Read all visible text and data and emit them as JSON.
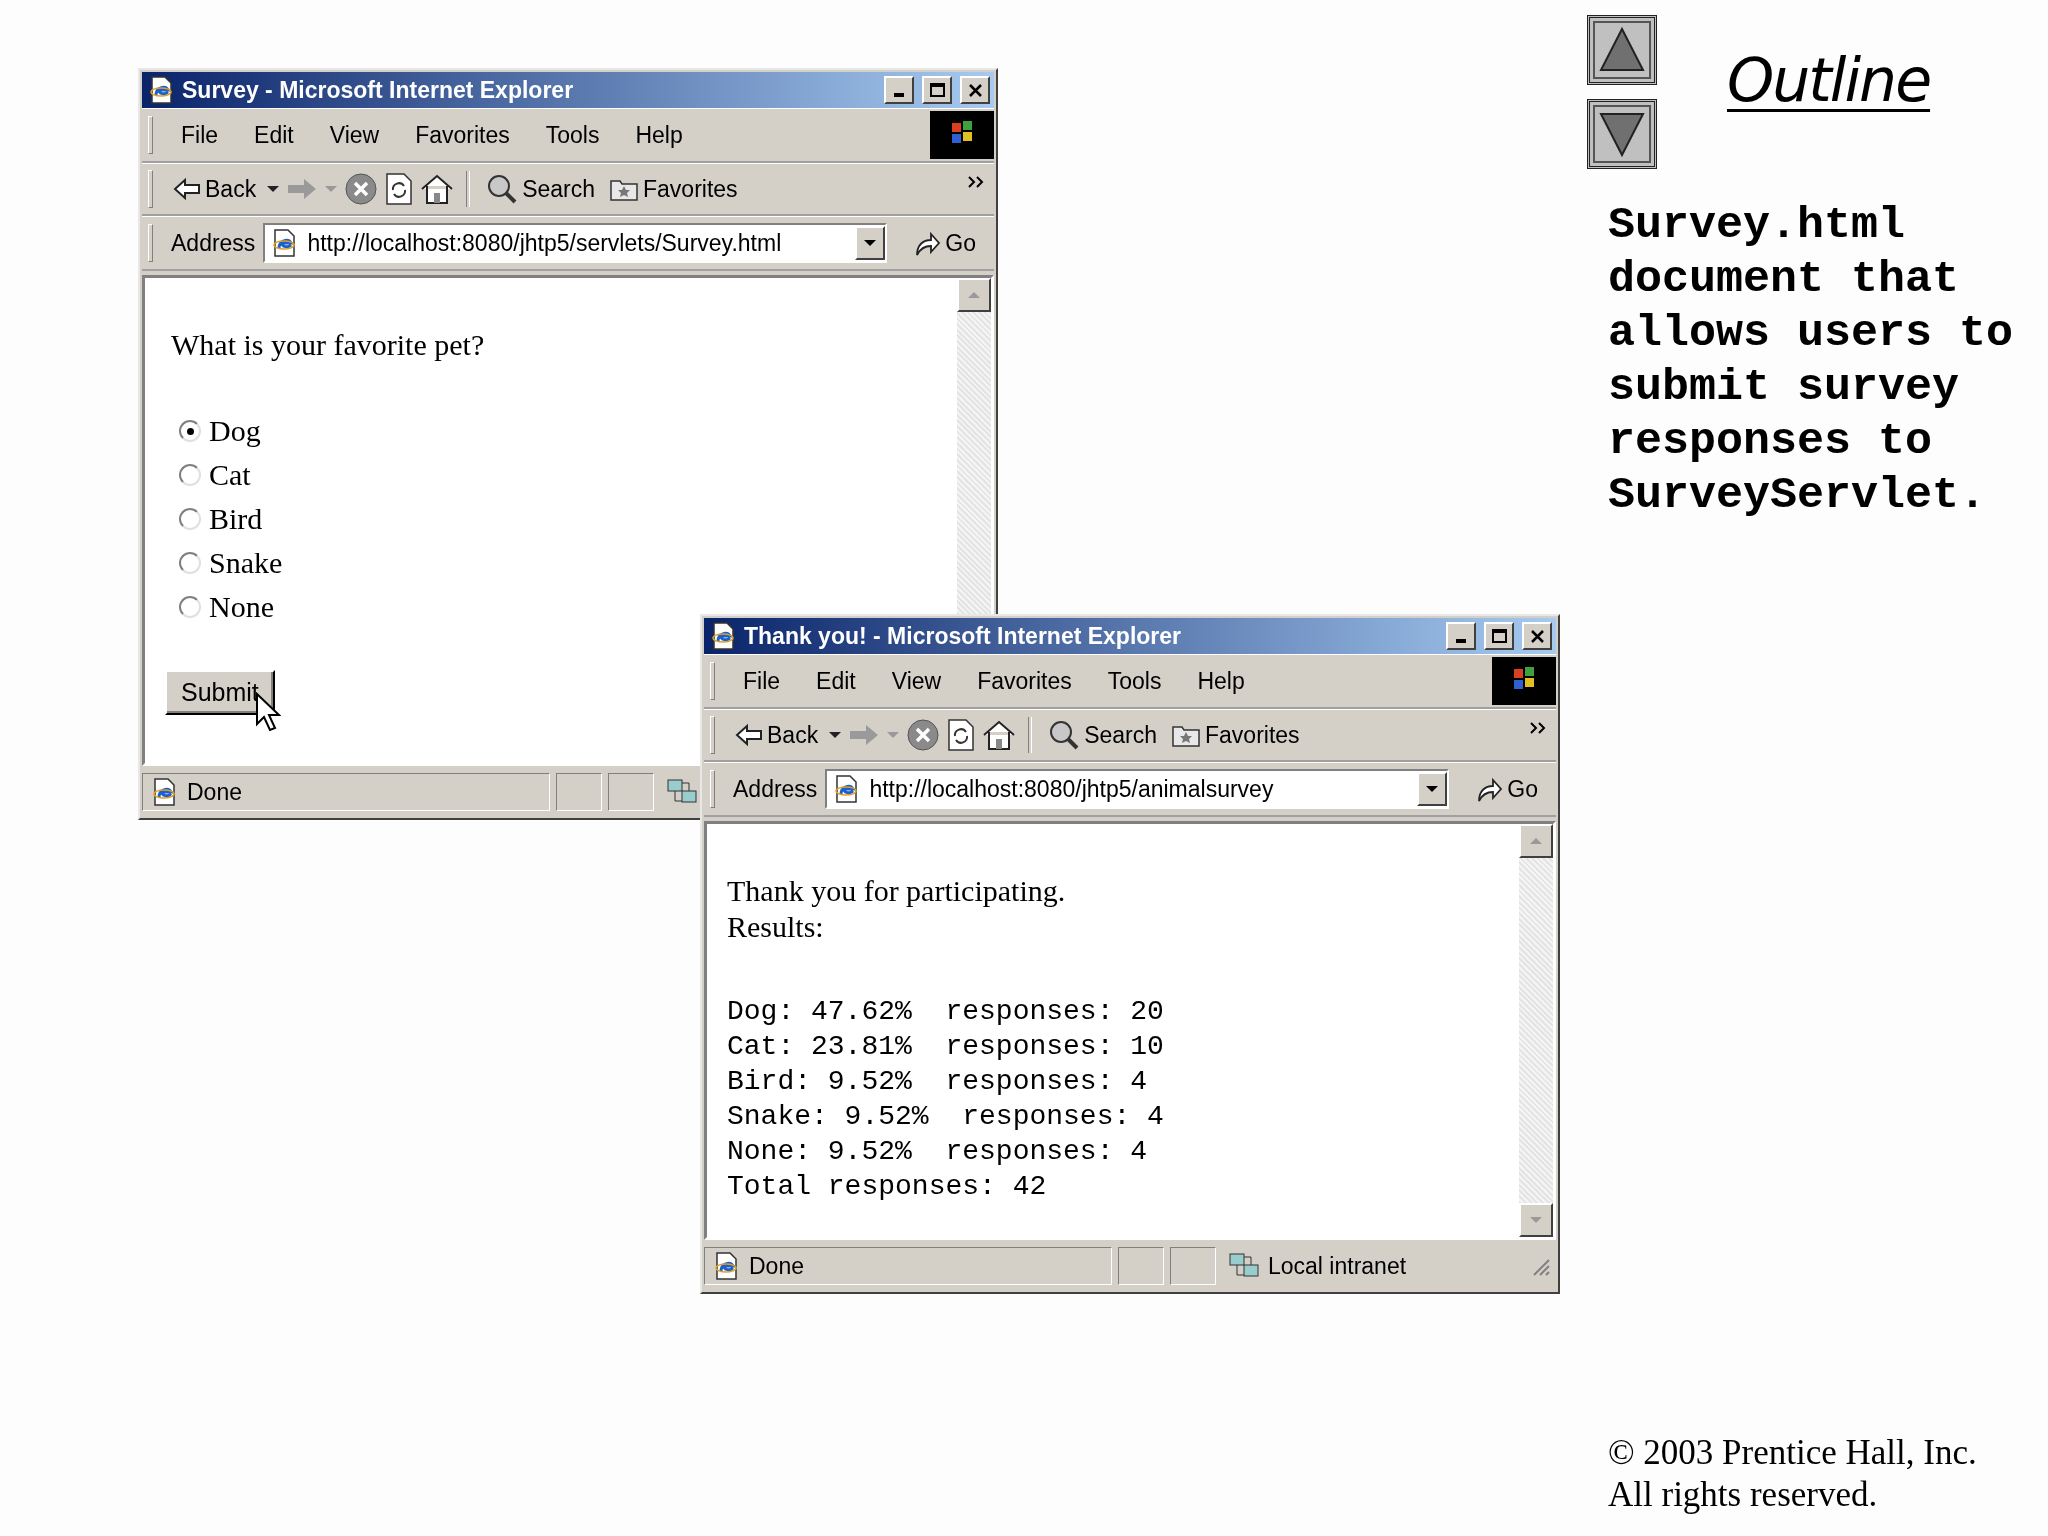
{
  "windows": [
    {
      "title": "Survey - Microsoft Internet Explorer",
      "menu": [
        "File",
        "Edit",
        "View",
        "Favorites",
        "Tools",
        "Help"
      ],
      "toolbar": {
        "back": "Back",
        "search": "Search",
        "favorites": "Favorites"
      },
      "address": {
        "label": "Address",
        "url": "http://localhost:8080/jhtp5/servlets/Survey.html",
        "go": "Go"
      },
      "page": {
        "kind": "form",
        "question": "What is your favorite pet?",
        "options": [
          {
            "label": "Dog",
            "selected": true
          },
          {
            "label": "Cat",
            "selected": false
          },
          {
            "label": "Bird",
            "selected": false
          },
          {
            "label": "Snake",
            "selected": false
          },
          {
            "label": "None",
            "selected": false
          }
        ],
        "submit": "Submit"
      },
      "status": {
        "text": "Done"
      }
    },
    {
      "title": "Thank you! - Microsoft Internet Explorer",
      "menu": [
        "File",
        "Edit",
        "View",
        "Favorites",
        "Tools",
        "Help"
      ],
      "toolbar": {
        "back": "Back",
        "search": "Search",
        "favorites": "Favorites"
      },
      "address": {
        "label": "Address",
        "url": "http://localhost:8080/jhtp5/animalsurvey",
        "go": "Go"
      },
      "page": {
        "kind": "results",
        "lines": [
          "Thank you for participating.",
          "Results:"
        ],
        "results": [
          "Dog: 47.62%  responses: 20",
          "Cat: 23.81%  responses: 10",
          "Bird: 9.52%  responses: 4",
          "Snake: 9.52%  responses: 4",
          "None: 9.52%  responses: 4",
          "Total responses: 42"
        ]
      },
      "status": {
        "text": "Done",
        "zone": "Local intranet"
      }
    }
  ],
  "outline": {
    "title": "Outline",
    "description": "Survey.html document that allows users to submit survey responses to SurveyServlet."
  },
  "copyright": [
    "© 2003 Prentice Hall, Inc.",
    "All rights reserved."
  ]
}
